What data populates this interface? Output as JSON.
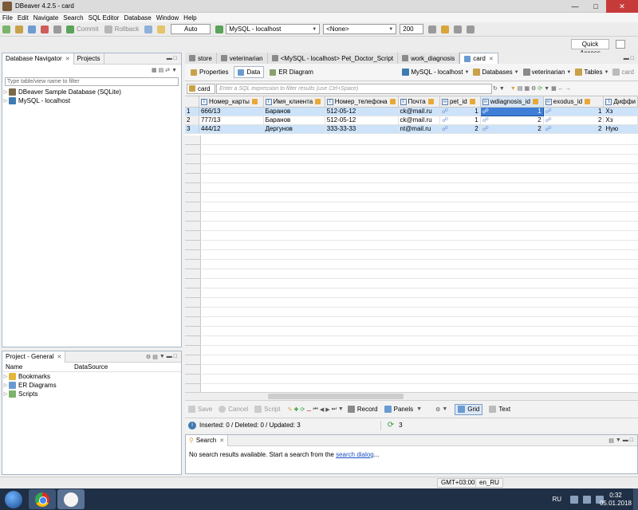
{
  "window": {
    "title": "DBeaver 4.2.5 - card"
  },
  "menu": [
    "File",
    "Edit",
    "Navigate",
    "Search",
    "SQL Editor",
    "Database",
    "Window",
    "Help"
  ],
  "toolbar": {
    "commit_label": "Commit",
    "rollback_label": "Rollback",
    "transaction_mode": "Auto",
    "connection": "MySQL - localhost",
    "schema": "<None>",
    "result_limit": "200",
    "quick_access": "Quick Access"
  },
  "navigator": {
    "tabs": [
      "Database Navigator",
      "Projects"
    ],
    "filter_placeholder": "Type table/view name to filter",
    "items": [
      {
        "label": "DBeaver Sample Database (SQLite)"
      },
      {
        "label": "MySQL - localhost"
      }
    ]
  },
  "project": {
    "title": "Project - General",
    "columns": [
      "Name",
      "DataSource"
    ],
    "items": [
      {
        "label": "Bookmarks"
      },
      {
        "label": "ER Diagrams"
      },
      {
        "label": "Scripts"
      }
    ]
  },
  "editor": {
    "tabs": [
      "store",
      "veterinarian",
      "<MySQL - localhost> Pet_Doctor_Script",
      "work_diagnosis",
      "card"
    ],
    "active_tab": "card",
    "subtabs": [
      "Properties",
      "Data",
      "ER Diagram"
    ],
    "breadcrumbs": [
      "MySQL - localhost",
      "Databases",
      "veterinarian",
      "Tables",
      "card"
    ],
    "filter_label": "card",
    "filter_placeholder": "Enter a SQL expression to filter results (use Ctrl+Space)"
  },
  "grid": {
    "columns": [
      "Номер_карты",
      "Имя_клиента",
      "Номер_телефона",
      "Почта",
      "pet_id",
      "wdiagnosis_id",
      "exodus_id",
      "Диффи"
    ],
    "rows": [
      {
        "n": "1",
        "cells": [
          "666/13",
          "Баранов",
          "512-05-12",
          "ck@mail.ru",
          "1",
          "1",
          "1",
          "Хз"
        ]
      },
      {
        "n": "2",
        "cells": [
          "777/13",
          "Баранов",
          "512-05-12",
          "ck@mail.ru",
          "1",
          "2",
          "2",
          "Хз"
        ]
      },
      {
        "n": "3",
        "cells": [
          "444/12",
          "Дергунов",
          "333-33-33",
          "nt@mail.ru",
          "2",
          "2",
          "2",
          "Ную"
        ]
      }
    ]
  },
  "bottombar": {
    "save": "Save",
    "cancel": "Cancel",
    "script": "Script",
    "record": "Record",
    "panels": "Panels",
    "grid": "Grid",
    "text": "Text"
  },
  "status": {
    "summary": "Inserted: 0 / Deleted: 0 / Updated: 3",
    "row_count": "3"
  },
  "search": {
    "tab": "Search",
    "message": "No search results available. Start a search from the ",
    "link": "search dialog",
    "ellipsis": "..."
  },
  "statusline": {
    "timezone": "GMT+03:00",
    "locale": "en_RU"
  },
  "taskbar": {
    "lang": "RU",
    "time": "0:32",
    "date": "05.01.2018"
  }
}
